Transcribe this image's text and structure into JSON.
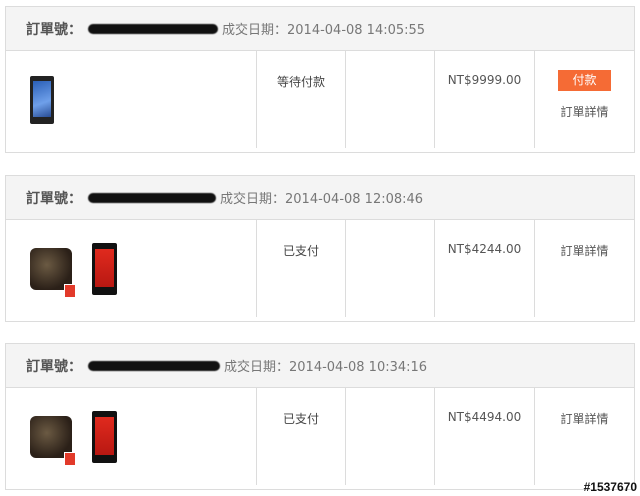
{
  "orders": [
    {
      "order_no_label": "訂單號：",
      "date_text": "成交日期：2014-04-08 14:05:55",
      "status": "等待付款",
      "price": "NT$9999.00",
      "pay_label": "付款",
      "detail_label": "訂單詳情",
      "products": [
        "phone-blue"
      ]
    },
    {
      "order_no_label": "訂單號：",
      "date_text": "成交日期：2014-04-08 12:08:46",
      "status": "已支付",
      "price": "NT$4244.00",
      "detail_label": "訂單詳情",
      "products": [
        "earphones",
        "phone-red"
      ]
    },
    {
      "order_no_label": "訂單號：",
      "date_text": "成交日期：2014-04-08 10:34:16",
      "status": "已支付",
      "price": "NT$4494.00",
      "detail_label": "訂單詳情",
      "products": [
        "earphones",
        "phone-red"
      ]
    }
  ],
  "watermark": "#1537670",
  "colors": {
    "pay_button": "#f56b35",
    "header_bg": "#f4f4f4",
    "border": "#dcdcdc"
  }
}
